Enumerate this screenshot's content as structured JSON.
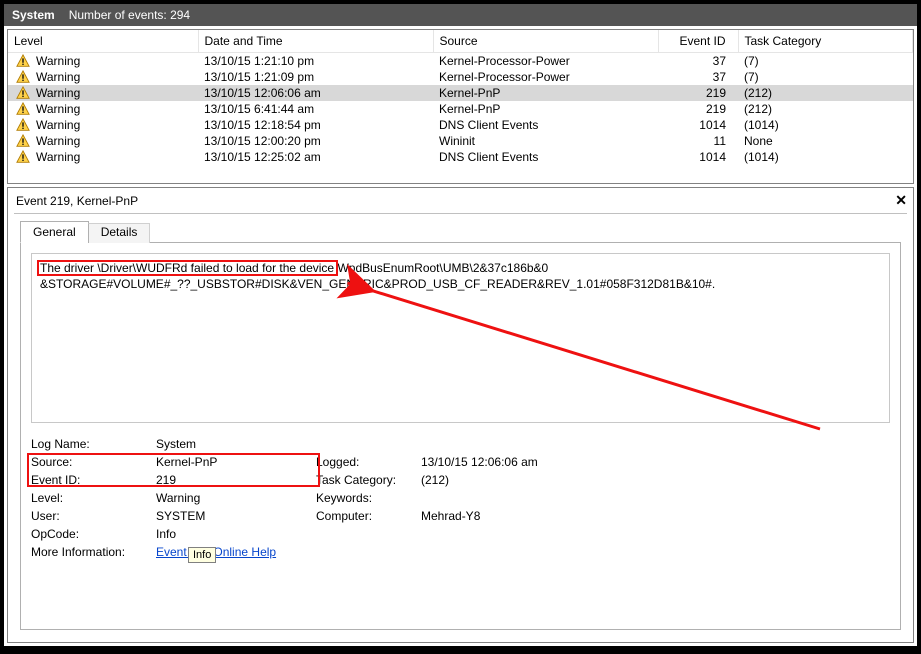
{
  "titlebar": {
    "name": "System",
    "count_label": "Number of events: 294"
  },
  "columns": {
    "level": "Level",
    "date": "Date and Time",
    "source": "Source",
    "eventid": "Event ID",
    "task": "Task Category"
  },
  "rows": [
    {
      "level": "Warning",
      "date": "13/10/15 1:21:10 pm",
      "source": "Kernel-Processor-Power",
      "eventid": "37",
      "task": "(7)"
    },
    {
      "level": "Warning",
      "date": "13/10/15 1:21:09 pm",
      "source": "Kernel-Processor-Power",
      "eventid": "37",
      "task": "(7)"
    },
    {
      "level": "Warning",
      "date": "13/10/15 12:06:06 am",
      "source": "Kernel-PnP",
      "eventid": "219",
      "task": "(212)",
      "selected": true
    },
    {
      "level": "Warning",
      "date": "13/10/15 6:41:44 am",
      "source": "Kernel-PnP",
      "eventid": "219",
      "task": "(212)"
    },
    {
      "level": "Warning",
      "date": "13/10/15 12:18:54 pm",
      "source": "DNS Client Events",
      "eventid": "1014",
      "task": "(1014)"
    },
    {
      "level": "Warning",
      "date": "13/10/15 12:00:20 pm",
      "source": "Wininit",
      "eventid": "11",
      "task": "None"
    },
    {
      "level": "Warning",
      "date": "13/10/15 12:25:02 am",
      "source": "DNS Client Events",
      "eventid": "1014",
      "task": "(1014)"
    }
  ],
  "detail": {
    "title": "Event 219, Kernel-PnP",
    "tabs": {
      "general": "General",
      "details": "Details"
    },
    "description_line1a": "The driver \\Driver\\WUDFRd failed to load for the device ",
    "description_line1b": "WpdBusEnumRoot\\UMB\\2&37c186b&0",
    "description_line2": "&STORAGE#VOLUME#_??_USBSTOR#DISK&VEN_GENERIC&PROD_USB_CF_READER&REV_1.01#058F312D81B&10#.",
    "props": {
      "logname_label": "Log Name:",
      "logname": "System",
      "source_label": "Source:",
      "source": "Kernel-PnP",
      "logged_label": "Logged:",
      "logged": "13/10/15 12:06:06 am",
      "eventid_label": "Event ID:",
      "eventid": "219",
      "taskcat_label": "Task Category:",
      "taskcat": "(212)",
      "level_label": "Level:",
      "level": "Warning",
      "keywords_label": "Keywords:",
      "keywords": "",
      "user_label": "User:",
      "user": "SYSTEM",
      "computer_label": "Computer:",
      "computer": "Mehrad-Y8",
      "opcode_label": "OpCode:",
      "opcode": "Info",
      "moreinfo_label": "More Information:",
      "moreinfo_link": "Event Log Online Help"
    },
    "tooltip": "Info"
  }
}
